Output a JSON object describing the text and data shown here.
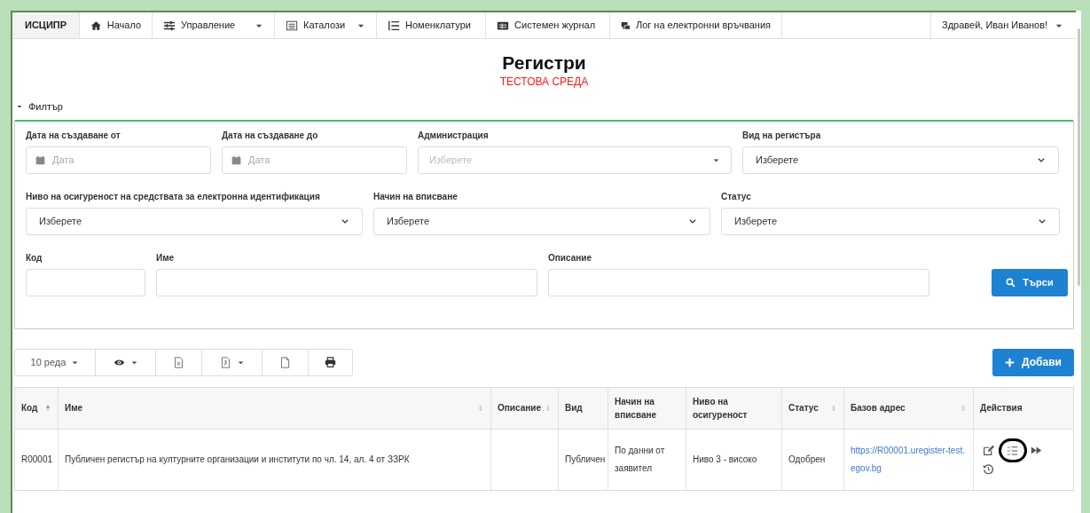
{
  "navbar": {
    "brand": "ИСЦИПР",
    "items": [
      {
        "label": "Начало",
        "kind": "home",
        "dropdown": false
      },
      {
        "label": "Управление",
        "kind": "sliders",
        "dropdown": true
      },
      {
        "label": "Каталози",
        "kind": "catalog",
        "dropdown": true
      },
      {
        "label": "Номенклатури",
        "kind": "list",
        "dropdown": false
      },
      {
        "label": "Системен журнал",
        "kind": "journal",
        "dropdown": false
      },
      {
        "label": "Лог на електронни връчвания",
        "kind": "delivery",
        "dropdown": false
      }
    ],
    "user": {
      "label": "Здравей, Иван Иванов!",
      "dropdown": true
    }
  },
  "page": {
    "title": "Регистри",
    "environment": "ТЕСТОВА СРЕДА"
  },
  "filter": {
    "toggle": "Филтър",
    "expanded": true,
    "fields": [
      {
        "kind": "date",
        "label": "Дата на създаване от",
        "placeholder": "Дата"
      },
      {
        "kind": "date",
        "label": "Дата на създаване до",
        "placeholder": "Дата"
      },
      {
        "kind": "combo",
        "label": "Администрация",
        "placeholder": "Изберете"
      },
      {
        "kind": "select",
        "label": "Вид на регистъра",
        "value": "Изберете"
      },
      {
        "kind": "select",
        "label": "Ниво на осигуреност на средствата за електронна идентификация",
        "value": "Изберете"
      },
      {
        "kind": "select",
        "label": "Начин на вписване",
        "value": "Изберете"
      },
      {
        "kind": "select",
        "label": "Статус",
        "value": "Изберете"
      },
      {
        "kind": "text",
        "label": "Код"
      },
      {
        "kind": "text",
        "label": "Име"
      },
      {
        "kind": "text",
        "label": "Описание"
      }
    ],
    "search_button": "Търси"
  },
  "toolbar": {
    "buttons": [
      {
        "kind": "length",
        "label": "10 реда",
        "dropdown": true
      },
      {
        "kind": "columns",
        "dropdown": true
      },
      {
        "kind": "excel",
        "dropdown": false
      },
      {
        "kind": "pdf",
        "dropdown": true
      },
      {
        "kind": "file",
        "dropdown": false
      },
      {
        "kind": "print",
        "dropdown": false
      }
    ],
    "add_button": "Добави"
  },
  "table": {
    "columns": [
      {
        "label": "Код",
        "sortable": true,
        "sorted": true
      },
      {
        "label": "Име",
        "sortable": true,
        "sorted": false
      },
      {
        "label": "Описание",
        "sortable": true,
        "sorted": false
      },
      {
        "label": "Вид",
        "sortable": false,
        "sorted": false
      },
      {
        "label": "Начин на вписване",
        "sortable": false,
        "sorted": false
      },
      {
        "label": "Ниво на осигуреност",
        "sortable": false,
        "sorted": false
      },
      {
        "label": "Статус",
        "sortable": true,
        "sorted": false
      },
      {
        "label": "Базов адрес",
        "sortable": true,
        "sorted": false
      },
      {
        "label": "Действия",
        "sortable": false,
        "sorted": false
      }
    ],
    "rows": [
      {
        "cells": [
          "R00001",
          "Публичен регистър на културните организации и институти по чл. 14, ал. 4 от ЗЗРК",
          "",
          "Публичен",
          "По данни от заявител",
          "Ниво 3 - високо",
          "Одобрен",
          "https://R00001.uregister-test.egov.bg"
        ],
        "actions": [
          {
            "kind": "edit",
            "highlighted": false
          },
          {
            "kind": "checklist",
            "highlighted": true
          },
          {
            "kind": "forward",
            "highlighted": false
          },
          {
            "kind": "history",
            "highlighted": false
          }
        ]
      }
    ]
  }
}
